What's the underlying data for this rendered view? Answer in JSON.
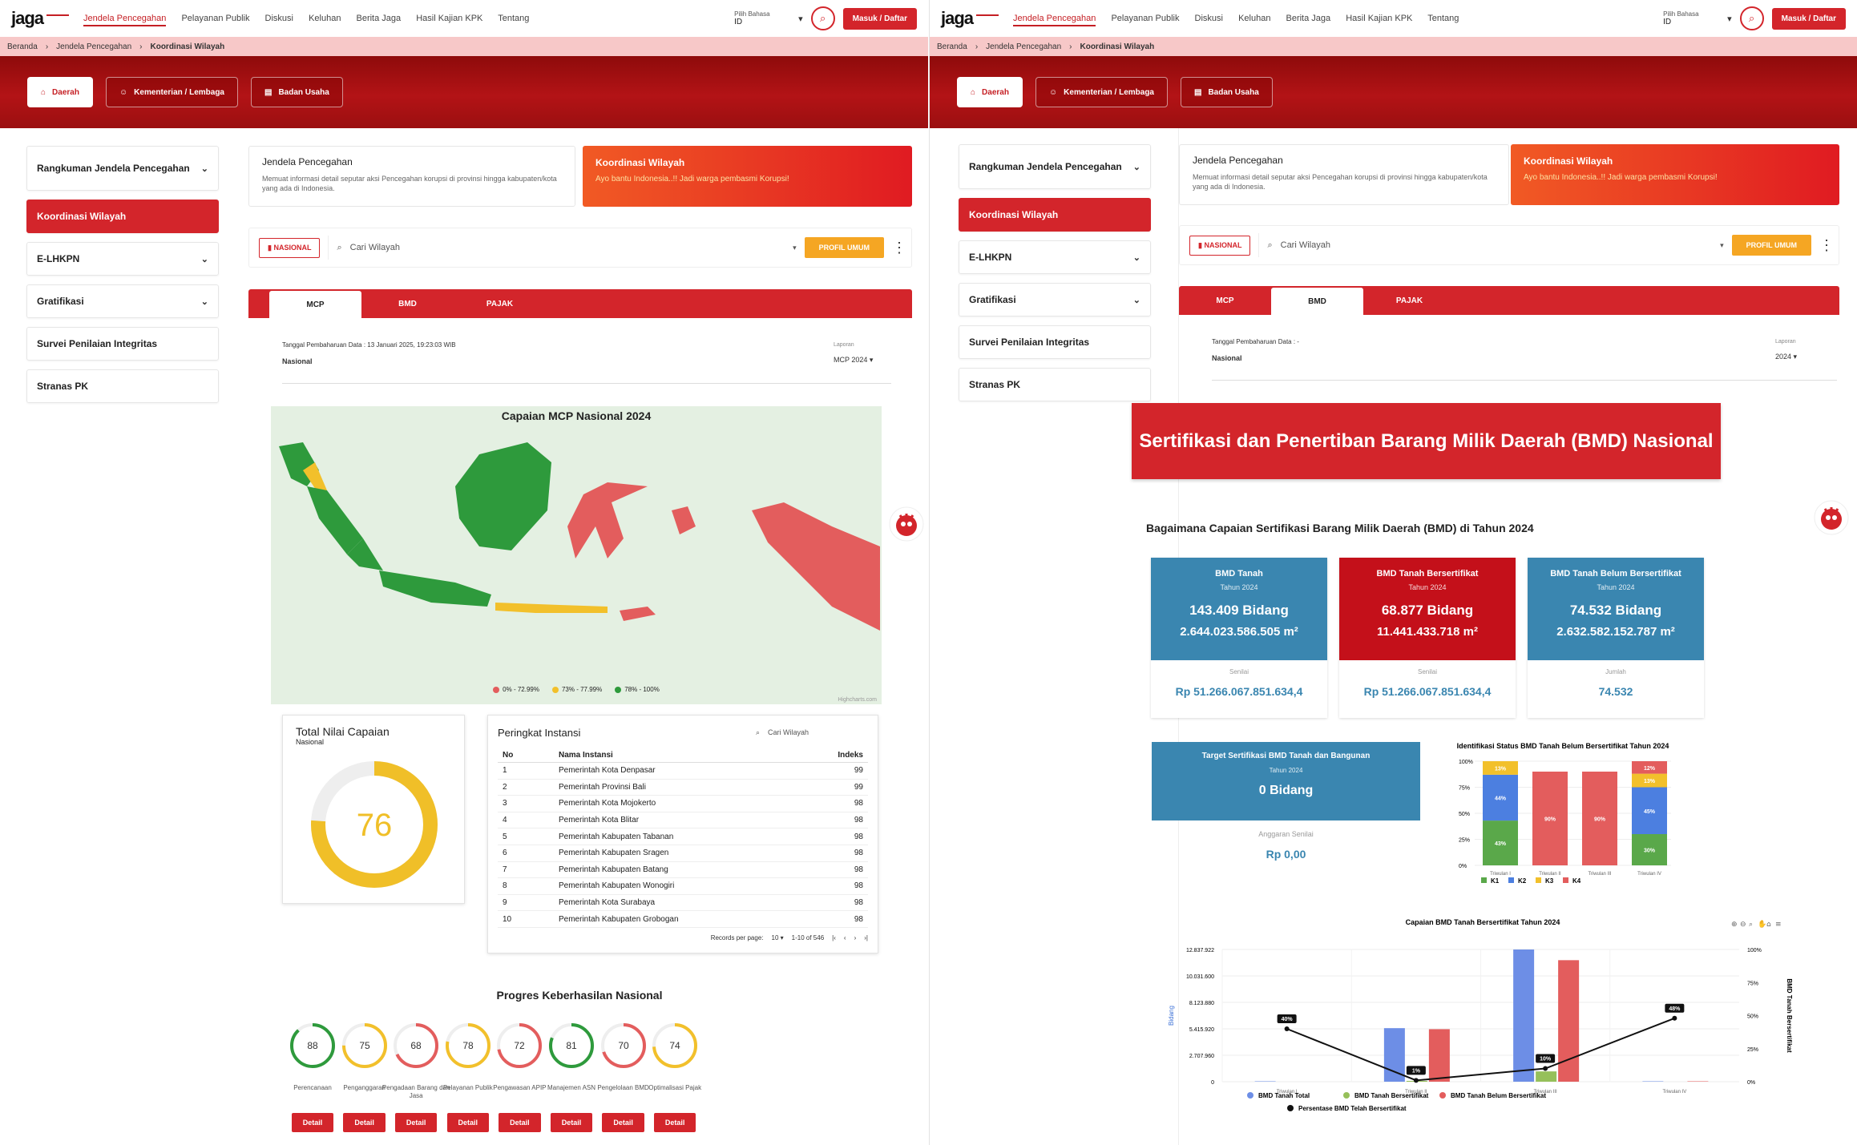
{
  "left": {
    "topbar": {
      "logo": "jaga",
      "nav": [
        "Jendela Pencegahan",
        "Pelayanan Publik",
        "Diskusi",
        "Keluhan",
        "Berita Jaga",
        "Hasil Kajian KPK",
        "Tentang"
      ],
      "lang_label": "Pilih Bahasa",
      "lang_value": "ID",
      "login": "Masuk / Daftar"
    },
    "breadcrumb": [
      "Beranda",
      "Jendela Pencegahan",
      "Koordinasi Wilayah"
    ],
    "hero_tabs": [
      "Daerah",
      "Kementerian / Lembaga",
      "Badan Usaha"
    ],
    "sidebar": [
      "Rangkuman Jendela Pencegahan",
      "Koordinasi Wilayah",
      "E-LHKPN",
      "Gratifikasi",
      "Survei Penilaian Integritas",
      "Stranas PK"
    ],
    "info_card": {
      "title": "Jendela Pencegahan",
      "desc": "Memuat informasi detail seputar aksi Pencegahan korupsi di provinsi hingga kabupaten/kota yang ada di Indonesia."
    },
    "red_card": {
      "title": "Koordinasi Wilayah",
      "desc": "Ayo bantu Indonesia..!! Jadi warga pembasmi Korupsi!"
    },
    "filter": {
      "nasional": "NASIONAL",
      "search_placeholder": "Cari Wilayah",
      "profil": "PROFIL UMUM"
    },
    "tabs": [
      "MCP",
      "BMD",
      "PAJAK"
    ],
    "meta": {
      "date": "Tanggal Pembaharuan Data : 13 Januari 2025, 19:23:03 WIB",
      "scope": "Nasional",
      "laporan_label": "Laporan",
      "laporan_value": "MCP 2024"
    },
    "map": {
      "title": "Capaian MCP Nasional 2024",
      "legend": [
        "0% - 72.99%",
        "73% - 77.99%",
        "78% - 100%"
      ],
      "legend_colors": [
        "#e35d5d",
        "#f2c02b",
        "#2e9a3c"
      ],
      "credit": "Highcharts.com"
    },
    "gauge": {
      "title": "Total Nilai Capaian",
      "sub": "Nasional",
      "value": "76",
      "fraction": 0.76
    },
    "ranking": {
      "title": "Peringkat Instansi",
      "search": "Cari Wilayah",
      "headers": [
        "No",
        "Nama Instansi",
        "Indeks"
      ],
      "rows": [
        [
          "1",
          "Pemerintah Kota Denpasar",
          "99"
        ],
        [
          "2",
          "Pemerintah Provinsi Bali",
          "99"
        ],
        [
          "3",
          "Pemerintah Kota Mojokerto",
          "98"
        ],
        [
          "4",
          "Pemerintah Kota Blitar",
          "98"
        ],
        [
          "5",
          "Pemerintah Kabupaten Tabanan",
          "98"
        ],
        [
          "6",
          "Pemerintah Kabupaten Sragen",
          "98"
        ],
        [
          "7",
          "Pemerintah Kabupaten Batang",
          "98"
        ],
        [
          "8",
          "Pemerintah Kabupaten Wonogiri",
          "98"
        ],
        [
          "9",
          "Pemerintah Kota Surabaya",
          "98"
        ],
        [
          "10",
          "Pemerintah Kabupaten Grobogan",
          "98"
        ]
      ],
      "records_label": "Records per page:",
      "records_value": "10",
      "range": "1-10 of 546"
    },
    "progress": {
      "title": "Progres Keberhasilan Nasional",
      "detail": "Detail",
      "items": [
        {
          "label": "Perencanaan",
          "value": "88",
          "color": "#2e9a3c"
        },
        {
          "label": "Penganggaran",
          "value": "75",
          "color": "#f2c02b"
        },
        {
          "label": "Pengadaan Barang dan Jasa",
          "value": "68",
          "color": "#e35d5d"
        },
        {
          "label": "Pelayanan Publik",
          "value": "78",
          "color": "#f2c02b"
        },
        {
          "label": "Pengawasan APIP",
          "value": "72",
          "color": "#e35d5d"
        },
        {
          "label": "Manajemen ASN",
          "value": "81",
          "color": "#2e9a3c"
        },
        {
          "label": "Pengelolaan BMD",
          "value": "70",
          "color": "#e35d5d"
        },
        {
          "label": "Optimalisasi Pajak",
          "value": "74",
          "color": "#f2c02b"
        }
      ]
    }
  },
  "right": {
    "meta": {
      "date": "Tanggal Pembaharuan Data : -",
      "scope": "Nasional",
      "laporan_label": "Laporan",
      "laporan_value": "2024"
    },
    "banner": "Sertifikasi dan Penertiban Barang Milik Daerah (BMD) Nasional",
    "question": "Bagaimana Capaian Sertifikasi Barang Milik Daerah (BMD) di Tahun 2024",
    "cards": [
      {
        "title": "BMD Tanah",
        "year": "Tahun 2024",
        "v1": "143.409 Bidang",
        "v2": "2.644.023.586.505 m²",
        "lbl": "Senilai",
        "val": "Rp 51.266.067.851.634,4",
        "color": "#3a86b0"
      },
      {
        "title": "BMD Tanah Bersertifikat",
        "year": "Tahun 2024",
        "v1": "68.877 Bidang",
        "v2": "11.441.433.718 m²",
        "lbl": "Senilai",
        "val": "Rp 51.266.067.851.634,4",
        "color": "#c4101a"
      },
      {
        "title": "BMD Tanah Belum Bersertifikat",
        "year": "Tahun 2024",
        "v1": "74.532 Bidang",
        "v2": "2.632.582.152.787 m²",
        "lbl": "Jumlah",
        "val": "74.532",
        "color": "#3a86b0"
      }
    ],
    "target": {
      "title": "Target Sertifikasi BMD Tanah dan Bangunan",
      "year": "Tahun 2024",
      "value": "0 Bidang",
      "lbl": "Anggaran Senilai",
      "val": "Rp 0,00"
    }
  },
  "chart_data": [
    {
      "type": "bar",
      "title": "Identifikasi Status BMD Tanah Belum Bersertifikat Tahun 2024",
      "stacked": true,
      "categories": [
        "Triwulan I",
        "Triwulan II",
        "Triwulan III",
        "Triwulan IV"
      ],
      "yticks": [
        "100%",
        "75%",
        "50%",
        "25%",
        "0%"
      ],
      "series": [
        {
          "name": "K1",
          "color": "#5aa84a",
          "values": [
            43,
            0,
            0,
            30
          ]
        },
        {
          "name": "K2",
          "color": "#4c7fe0",
          "values": [
            44,
            0,
            0,
            45
          ]
        },
        {
          "name": "K3",
          "color": "#f2c02b",
          "values": [
            13,
            0,
            0,
            13
          ]
        },
        {
          "name": "K4",
          "color": "#e35d5d",
          "values": [
            0,
            90,
            90,
            12
          ]
        }
      ],
      "data_labels": [
        [
          "43%",
          "44%",
          "13%",
          ""
        ],
        [
          "",
          "",
          "",
          "90%"
        ],
        [
          "",
          "",
          "",
          "90%"
        ],
        [
          "30%",
          "45%",
          "13%",
          ""
        ]
      ]
    },
    {
      "type": "bar",
      "title": "Capaian BMD Tanah Bersertifikat Tahun 2024",
      "categories": [
        "Triwulan I",
        "Triwulan II",
        "Triwulan III",
        "Triwulan IV"
      ],
      "ylabel": "Bidang",
      "y2label": "BMD Tanah Bersertifikat",
      "yticks": [
        "12.837.922",
        "10.031.600",
        "8.123.880",
        "5.415.920",
        "2.707.960",
        "0"
      ],
      "y2ticks": [
        "100%",
        "75%",
        "50%",
        "25%",
        "0%"
      ],
      "ylim": [
        0,
        12837922
      ],
      "series": [
        {
          "name": "BMD Tanah Total",
          "color": "#6d8ee6",
          "values": [
            40000,
            5200000,
            12837922,
            40000
          ]
        },
        {
          "name": "BMD Tanah Bersertifikat",
          "color": "#96c05a",
          "values": [
            0,
            80000,
            1000000,
            0
          ]
        },
        {
          "name": "BMD Tanah Belum Bersertifikat",
          "color": "#e35d5d",
          "values": [
            0,
            5100000,
            11800000,
            40000
          ]
        },
        {
          "name": "Persentase BMD Telah Bersertifikat",
          "color": "#111111",
          "type": "line",
          "values": [
            40,
            1,
            10,
            48
          ],
          "labels": [
            "40%",
            "1%",
            "10%",
            "48%"
          ]
        }
      ]
    }
  ]
}
